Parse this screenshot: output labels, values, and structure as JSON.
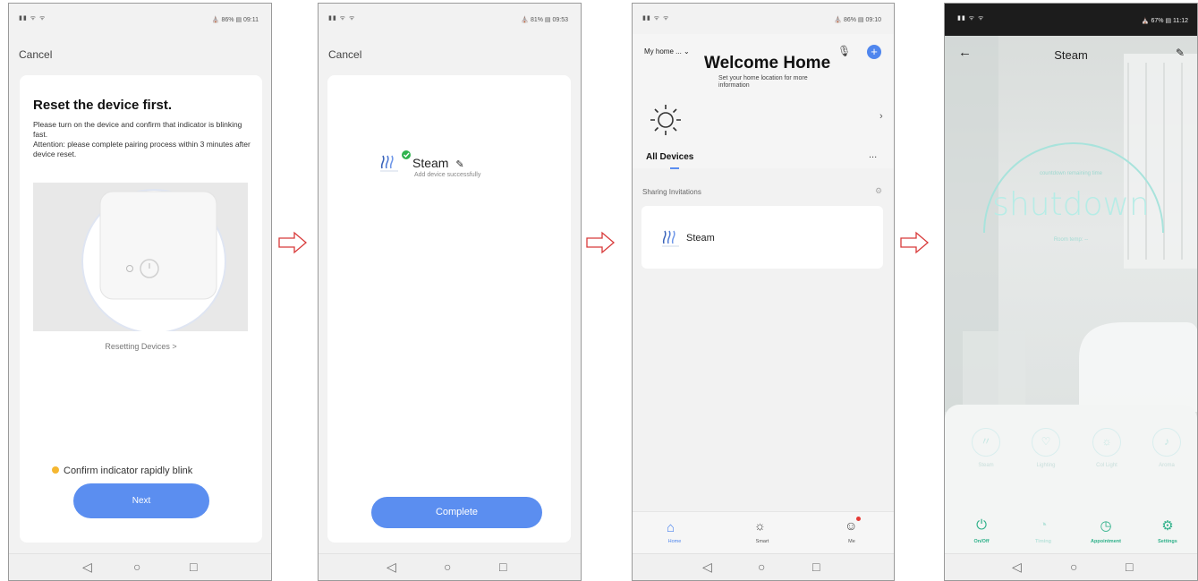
{
  "screen1": {
    "status_right": "⛪ 86% ▤ 09:11",
    "cancel": "Cancel",
    "title": "Reset the device first.",
    "instructions": "Please turn on the device and confirm that indicator is blinking fast.\nAttention: please complete pairing process within 3 minutes after device reset.",
    "reset_link": "Resetting Devices >",
    "confirm": "Confirm indicator rapidly blink",
    "next": "Next"
  },
  "screen2": {
    "status_right": "⛪ 81% ▤ 09:53",
    "cancel": "Cancel",
    "device_name": "Steam",
    "device_sub": "Add device successfully",
    "complete": "Complete"
  },
  "screen3": {
    "status_right": "⛪ 86% ▤ 09:10",
    "home_select": "My home ...",
    "welcome": "Welcome Home",
    "welcome_sub": "Set your home location for more information",
    "all_devices": "All Devices",
    "more": "...",
    "sharing": "Sharing Invitations",
    "device": "Steam",
    "tabs": [
      "Home",
      "Smart",
      "Me"
    ]
  },
  "screen4": {
    "status_right": "⛪ 67% ▤ 11:12",
    "title": "Steam",
    "countdown": "countdown remaining time",
    "shutdown": "shutdown",
    "room_temp": "Room temp: --",
    "functions": [
      "Steam",
      "Lighting",
      "Col Light",
      "Aroma"
    ],
    "bottom": [
      "On/Off",
      "Timing",
      "Appointment",
      "Settings"
    ]
  },
  "colors": {
    "accent": "#5b8ef0",
    "teal": "#2fb18a",
    "arrow": "#d83a3a"
  }
}
